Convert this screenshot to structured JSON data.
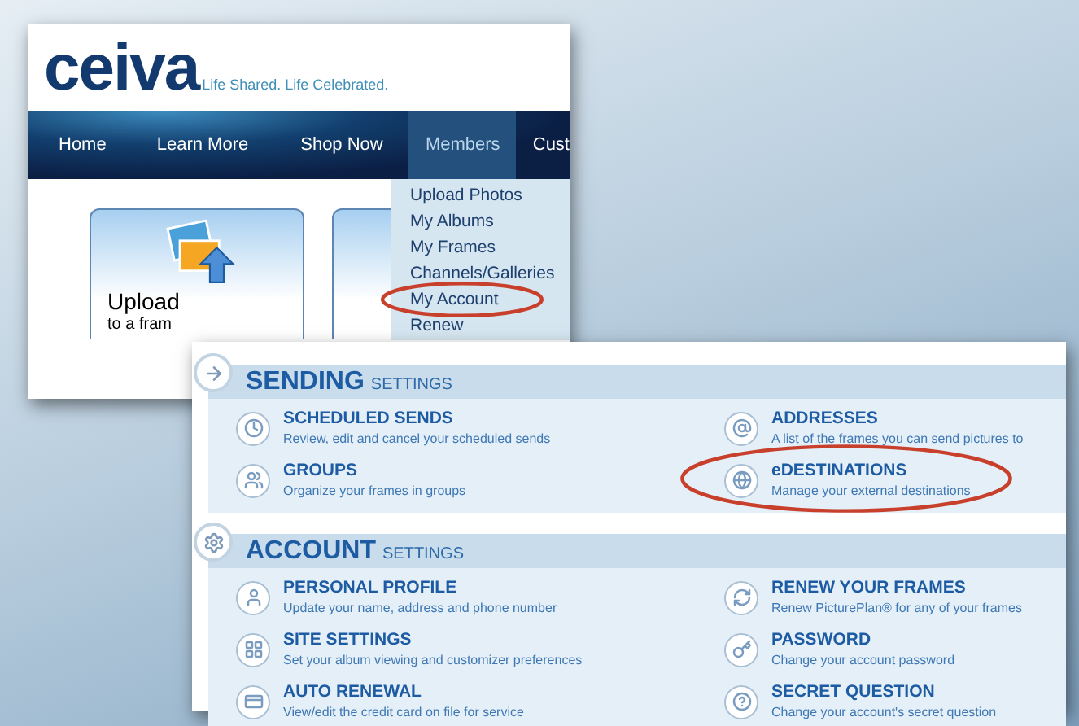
{
  "site_window": {
    "logo": "ceiva",
    "tagline": "Life Shared.  Life Celebrated.",
    "nav": [
      {
        "label": "Home",
        "selected": false
      },
      {
        "label": "Learn More",
        "selected": false
      },
      {
        "label": "Shop Now",
        "selected": false
      },
      {
        "label": "Members",
        "selected": true
      },
      {
        "label": "Cust",
        "selected": false
      }
    ],
    "dropdown": [
      {
        "label": "Upload Photos",
        "highlighted": false
      },
      {
        "label": "My Albums",
        "highlighted": false
      },
      {
        "label": "My Frames",
        "highlighted": false
      },
      {
        "label": "Channels/Galleries",
        "highlighted": false
      },
      {
        "label": "My Account",
        "highlighted": true
      },
      {
        "label": "Renew",
        "highlighted": false
      }
    ],
    "card": {
      "title": "Upload",
      "subtitle": "to a fram"
    }
  },
  "settings_window": {
    "sections": [
      {
        "title": "SENDING",
        "subtitle": "SETTINGS",
        "items": [
          {
            "title": "SCHEDULED SENDS",
            "description": "Review, edit and cancel your scheduled sends",
            "highlighted": false
          },
          {
            "title": "ADDRESSES",
            "description": "A list of the frames you can send pictures to",
            "highlighted": false
          },
          {
            "title": "GROUPS",
            "description": "Organize your frames in groups",
            "highlighted": false
          },
          {
            "title": "eDESTINATIONS",
            "description": "Manage your external destinations",
            "highlighted": true
          }
        ]
      },
      {
        "title": "ACCOUNT",
        "subtitle": "SETTINGS",
        "items": [
          {
            "title": "PERSONAL PROFILE",
            "description": "Update your name, address and phone number",
            "highlighted": false
          },
          {
            "title": "RENEW YOUR FRAMES",
            "description": "Renew PicturePlan® for any of your frames",
            "highlighted": false
          },
          {
            "title": "SITE SETTINGS",
            "description": "Set your album viewing and customizer preferences",
            "highlighted": false
          },
          {
            "title": "PASSWORD",
            "description": "Change your account password",
            "highlighted": false
          },
          {
            "title": "AUTO RENEWAL",
            "description": "View/edit the credit card on file for service",
            "highlighted": false
          },
          {
            "title": "SECRET QUESTION",
            "description": "Change your account's secret question",
            "highlighted": false
          }
        ]
      }
    ]
  }
}
